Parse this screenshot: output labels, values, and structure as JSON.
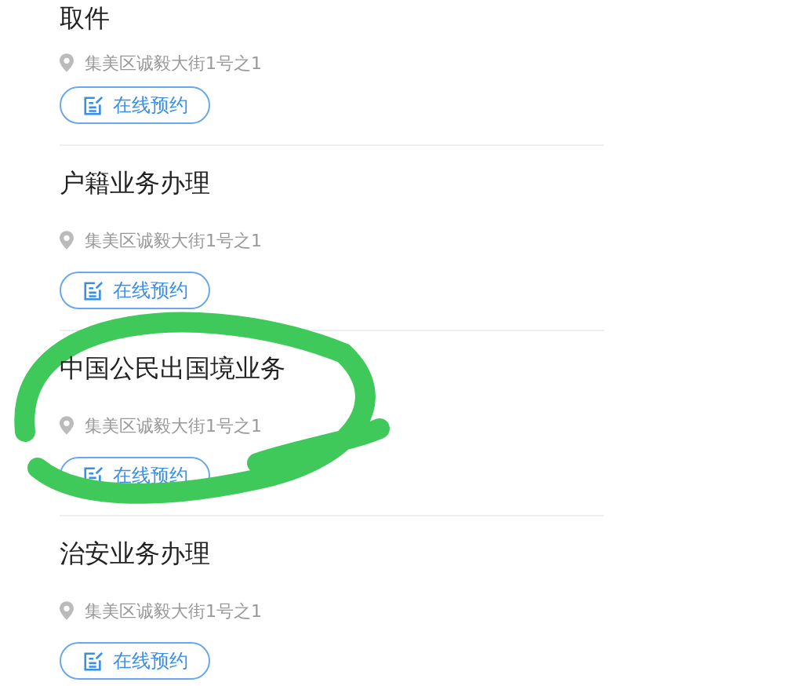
{
  "services": [
    {
      "title": "取件",
      "address": "集美区诚毅大街1号之1",
      "button": "在线预约",
      "highlighted": false
    },
    {
      "title": "户籍业务办理",
      "address": "集美区诚毅大街1号之1",
      "button": "在线预约",
      "highlighted": false
    },
    {
      "title": "中国公民出国境业务",
      "address": "集美区诚毅大街1号之1",
      "button": "在线预约",
      "highlighted": true
    },
    {
      "title": "治安业务办理",
      "address": "集美区诚毅大街1号之1",
      "button": "在线预约",
      "highlighted": false
    }
  ]
}
